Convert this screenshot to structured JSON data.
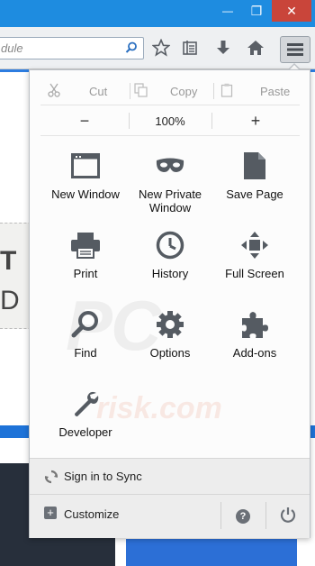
{
  "window": {
    "minimize_glyph": "—",
    "maximize_glyph": "❐",
    "close_glyph": "✕"
  },
  "toolbar": {
    "url_text": "dule",
    "icons": [
      "search-icon",
      "bookmark-star-icon",
      "reading-list-icon",
      "download-icon",
      "home-icon",
      "hamburger-menu-icon"
    ]
  },
  "page": {
    "partial_text_line1": "T",
    "partial_text_line2": "D F"
  },
  "menu": {
    "edit": {
      "cut": "Cut",
      "copy": "Copy",
      "paste": "Paste"
    },
    "zoom": {
      "minus": "−",
      "value": "100%",
      "plus": "+"
    },
    "tiles": [
      {
        "label": "New Window",
        "icon": "window-icon"
      },
      {
        "label": "New Private\nWindow",
        "icon": "private-mask-icon"
      },
      {
        "label": "Save Page",
        "icon": "document-icon"
      },
      {
        "label": "Print",
        "icon": "printer-icon"
      },
      {
        "label": "History",
        "icon": "clock-icon"
      },
      {
        "label": "Full Screen",
        "icon": "fullscreen-icon"
      },
      {
        "label": "Find",
        "icon": "magnifier-icon"
      },
      {
        "label": "Options",
        "icon": "gear-icon"
      },
      {
        "label": "Add-ons",
        "icon": "puzzle-icon"
      },
      {
        "label": "Developer",
        "icon": "wrench-icon"
      }
    ],
    "sync_label": "Sign in to Sync",
    "customize_label": "Customize"
  },
  "colors": {
    "titlebar": "#1e8ce0",
    "close": "#c9453a",
    "icon": "#5a5f66"
  }
}
